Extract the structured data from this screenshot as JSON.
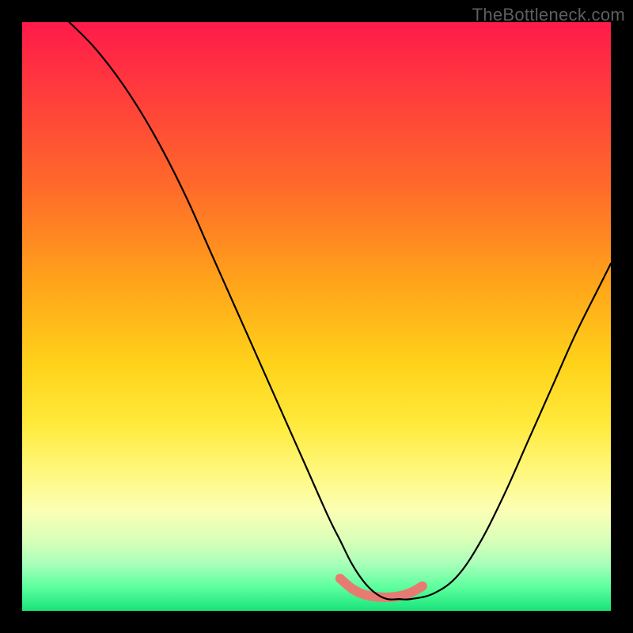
{
  "watermark": "TheBottleneck.com",
  "colors": {
    "background": "#000000",
    "gradient_top": "#ff1a4a",
    "gradient_bottom": "#19e37a",
    "curve": "#000000",
    "highlight": "#e77b72",
    "watermark": "#5e5e5e"
  },
  "chart_data": {
    "type": "line",
    "title": "",
    "xlabel": "",
    "ylabel": "",
    "xlim": [
      0,
      100
    ],
    "ylim": [
      0,
      100
    ],
    "grid": false,
    "legend": false,
    "series": [
      {
        "name": "bottleneck-curve",
        "x": [
          8,
          12,
          16,
          20,
          24,
          28,
          32,
          36,
          40,
          44,
          48,
          52,
          54,
          56,
          58,
          60,
          62,
          64,
          66,
          70,
          74,
          78,
          82,
          86,
          90,
          94,
          98,
          100
        ],
        "y": [
          100,
          96,
          91,
          85,
          78,
          70,
          61,
          52,
          43,
          34,
          25,
          16,
          12,
          8,
          5,
          3,
          2,
          2,
          2,
          3,
          6,
          12,
          20,
          29,
          38,
          47,
          55,
          59
        ]
      },
      {
        "name": "optimal-range-highlight",
        "x": [
          54,
          56,
          58,
          60,
          62,
          64,
          66,
          68
        ],
        "y": [
          5.5,
          3.8,
          2.8,
          2.4,
          2.3,
          2.5,
          3.1,
          4.2
        ]
      }
    ],
    "annotations": []
  }
}
